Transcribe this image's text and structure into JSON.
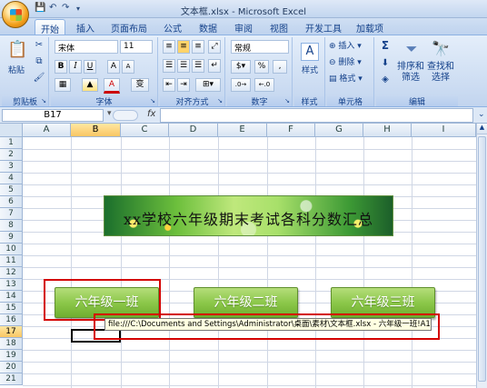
{
  "window": {
    "title": "文本框.xlsx - Microsoft Excel"
  },
  "tabs": [
    "开始",
    "插入",
    "页面布局",
    "公式",
    "数据",
    "审阅",
    "视图",
    "开发工具",
    "加载项"
  ],
  "active_tab": "开始",
  "ribbon": {
    "clipboard": {
      "label": "剪贴板",
      "paste": "粘贴"
    },
    "font": {
      "label": "字体",
      "name": "宋体",
      "size": "11",
      "bold": "B",
      "italic": "I",
      "underline": "U",
      "grow": "A",
      "shrink": "A",
      "color_letter": "A",
      "wen": "变"
    },
    "alignment": {
      "label": "对齐方式"
    },
    "number": {
      "label": "数字",
      "format": "常规",
      "percent": "%",
      "comma": ","
    },
    "styles": {
      "label": "样式",
      "button": "样式"
    },
    "cells": {
      "label": "单元格",
      "insert": "插入",
      "delete": "删除",
      "format": "格式"
    },
    "editing": {
      "label": "编辑",
      "sort": "排序和",
      "sort2": "筛选",
      "find": "查找和",
      "find2": "选择",
      "sigma": "Σ"
    }
  },
  "formula_bar": {
    "name_box": "B17",
    "fx": "fx",
    "value": ""
  },
  "columns": [
    "A",
    "B",
    "C",
    "D",
    "E",
    "F",
    "G",
    "H",
    "I"
  ],
  "rows": [
    "1",
    "2",
    "3",
    "4",
    "5",
    "6",
    "7",
    "8",
    "9",
    "10",
    "11",
    "12",
    "13",
    "14",
    "15",
    "16",
    "17",
    "18",
    "19",
    "20",
    "21"
  ],
  "selected_cell": "B17",
  "banner": {
    "text": "xx学校六年级期末考试各科分数汇总"
  },
  "shapes": [
    {
      "label": "六年级一班"
    },
    {
      "label": "六年级二班"
    },
    {
      "label": "六年级三班"
    }
  ],
  "tooltip": {
    "text": "file:///C:\\Documents and Settings\\Administrator\\桌面\\素材\\文本框.xlsx - 六年级一班!A1"
  },
  "colors": {
    "ribbon": "#c9daf1",
    "shape_green": "#8cc84a",
    "highlight_red": "#d40000",
    "tooltip_bg": "#ffffe1"
  }
}
